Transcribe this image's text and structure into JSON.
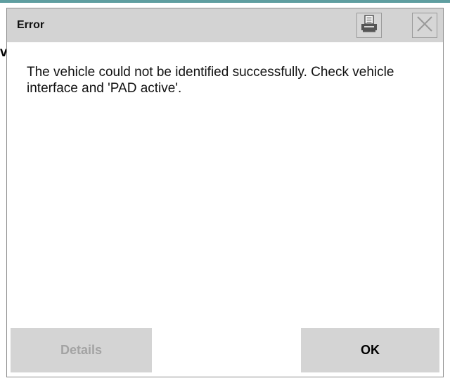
{
  "dialog": {
    "title": "Error",
    "message": "The vehicle could not be identified successfully. Check vehicle interface and 'PAD active'.",
    "buttons": {
      "details_label": "Details",
      "ok_label": "OK"
    },
    "icons": {
      "print": "printer-icon",
      "close": "close-icon"
    }
  },
  "background": {
    "fragment_text": "v"
  },
  "colors": {
    "titlebar": "#d3d3d3",
    "button_bg": "#d4d4d4",
    "disabled_text": "#a3a3a3",
    "accent_rule": "#5f9ea0"
  }
}
